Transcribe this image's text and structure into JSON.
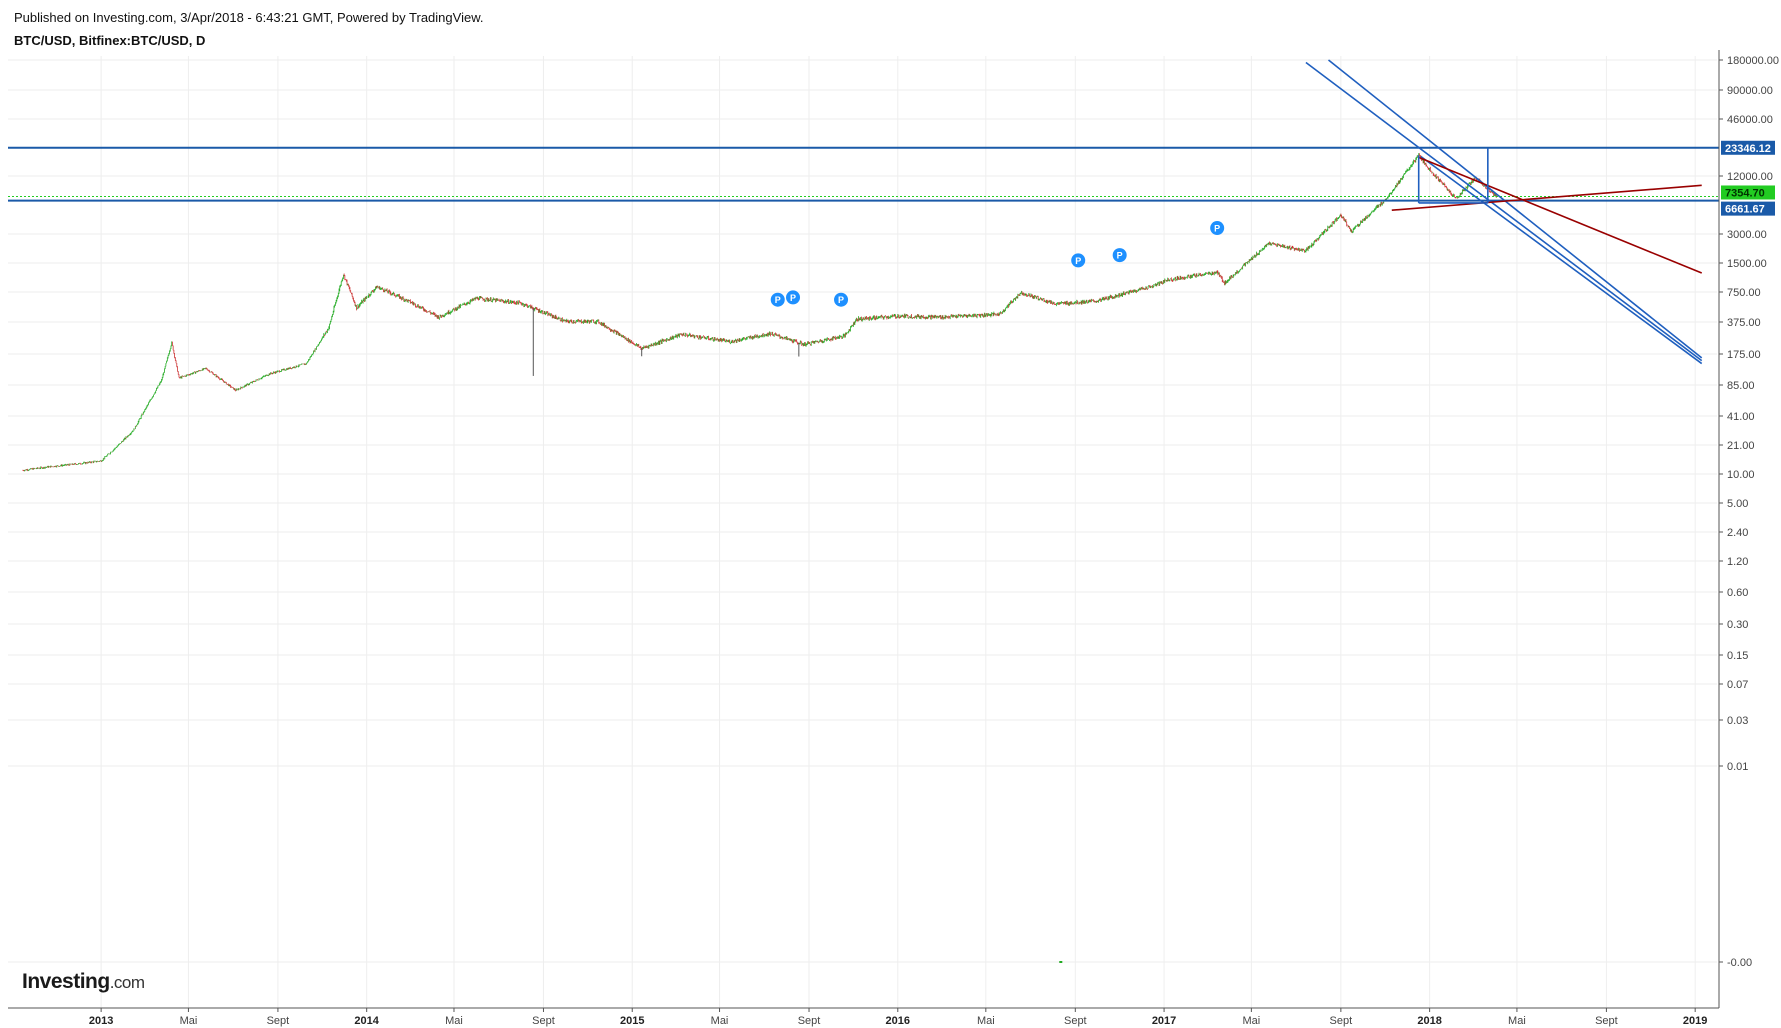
{
  "header": {
    "published": "Published on Investing.com, 3/Apr/2018 - 6:43:21 GMT, Powered by TradingView.",
    "symbol": "BTC/USD, Bitfinex:BTC/USD, D"
  },
  "logo": {
    "name": "Investing",
    "tld": ".com"
  },
  "colors": {
    "up": "#22aa22",
    "down": "#cc3333",
    "trend_blue": "#1f5fbf",
    "trend_red": "#990000",
    "badge_blue": "#1a5aa8",
    "badge_green": "#22cc22",
    "pivot": "#1e90ff",
    "grid": "#eeeeee"
  },
  "chart_data": {
    "type": "candlestick",
    "scale": "log",
    "grid": true,
    "x_ticks": [
      {
        "label": "2013",
        "date": "2013-01-01",
        "year": true
      },
      {
        "label": "Mai",
        "date": "2013-05-01"
      },
      {
        "label": "Sept",
        "date": "2013-09-01"
      },
      {
        "label": "2014",
        "date": "2014-01-01",
        "year": true
      },
      {
        "label": "Mai",
        "date": "2014-05-01"
      },
      {
        "label": "Sept",
        "date": "2014-09-01"
      },
      {
        "label": "2015",
        "date": "2015-01-01",
        "year": true
      },
      {
        "label": "Mai",
        "date": "2015-05-01"
      },
      {
        "label": "Sept",
        "date": "2015-09-01"
      },
      {
        "label": "2016",
        "date": "2016-01-01",
        "year": true
      },
      {
        "label": "Mai",
        "date": "2016-05-01"
      },
      {
        "label": "Sept",
        "date": "2016-09-01"
      },
      {
        "label": "2017",
        "date": "2017-01-01",
        "year": true
      },
      {
        "label": "Mai",
        "date": "2017-05-01"
      },
      {
        "label": "Sept",
        "date": "2017-09-01"
      },
      {
        "label": "2018",
        "date": "2018-01-01",
        "year": true
      },
      {
        "label": "Mai",
        "date": "2018-05-01"
      },
      {
        "label": "Sept",
        "date": "2018-09-01"
      },
      {
        "label": "2019",
        "date": "2019-01-01",
        "year": true
      }
    ],
    "y_ticks": [
      {
        "label": "180000.00",
        "value": 180000
      },
      {
        "label": "90000.00",
        "value": 90000
      },
      {
        "label": "46000.00",
        "value": 46000
      },
      {
        "label": "12000.00",
        "value": 12000
      },
      {
        "label": "3000.00",
        "value": 3000
      },
      {
        "label": "1500.00",
        "value": 1500
      },
      {
        "label": "750.00",
        "value": 750
      },
      {
        "label": "375.00",
        "value": 375
      },
      {
        "label": "175.00",
        "value": 175
      },
      {
        "label": "85.00",
        "value": 85
      },
      {
        "label": "41.00",
        "value": 41
      },
      {
        "label": "21.00",
        "value": 21
      },
      {
        "label": "10.00",
        "value": 10
      },
      {
        "label": "5.00",
        "value": 5
      },
      {
        "label": "2.40",
        "value": 2.4
      },
      {
        "label": "1.20",
        "value": 1.2
      },
      {
        "label": "0.60",
        "value": 0.6
      },
      {
        "label": "0.30",
        "value": 0.3
      },
      {
        "label": "0.15",
        "value": 0.15
      },
      {
        "label": "0.07",
        "value": 0.07
      },
      {
        "label": "0.03",
        "value": 0.03
      },
      {
        "label": "0.01",
        "value": 0.01
      },
      {
        "label": "-0.00",
        "value": 0.0001
      }
    ],
    "price_series": [
      {
        "date": "2012-09-15",
        "price": 11
      },
      {
        "date": "2012-10-20",
        "price": 12
      },
      {
        "date": "2012-12-01",
        "price": 13
      },
      {
        "date": "2013-01-01",
        "price": 14
      },
      {
        "date": "2013-02-15",
        "price": 30
      },
      {
        "date": "2013-03-25",
        "price": 95
      },
      {
        "date": "2013-04-08",
        "price": 230
      },
      {
        "date": "2013-04-18",
        "price": 100
      },
      {
        "date": "2013-05-25",
        "price": 125
      },
      {
        "date": "2013-07-05",
        "price": 75
      },
      {
        "date": "2013-08-20",
        "price": 110
      },
      {
        "date": "2013-10-10",
        "price": 140
      },
      {
        "date": "2013-11-10",
        "price": 330
      },
      {
        "date": "2013-11-30",
        "price": 1150
      },
      {
        "date": "2013-12-18",
        "price": 520
      },
      {
        "date": "2014-01-15",
        "price": 850
      },
      {
        "date": "2014-03-01",
        "price": 600
      },
      {
        "date": "2014-04-10",
        "price": 420
      },
      {
        "date": "2014-06-01",
        "price": 650
      },
      {
        "date": "2014-08-01",
        "price": 580
      },
      {
        "date": "2014-10-01",
        "price": 380
      },
      {
        "date": "2014-11-15",
        "price": 380
      },
      {
        "date": "2015-01-14",
        "price": 200
      },
      {
        "date": "2015-03-10",
        "price": 280
      },
      {
        "date": "2015-05-15",
        "price": 235
      },
      {
        "date": "2015-07-10",
        "price": 285
      },
      {
        "date": "2015-08-25",
        "price": 220
      },
      {
        "date": "2015-10-20",
        "price": 270
      },
      {
        "date": "2015-11-05",
        "price": 400
      },
      {
        "date": "2016-01-01",
        "price": 430
      },
      {
        "date": "2016-03-01",
        "price": 420
      },
      {
        "date": "2016-05-20",
        "price": 450
      },
      {
        "date": "2016-06-18",
        "price": 740
      },
      {
        "date": "2016-08-05",
        "price": 570
      },
      {
        "date": "2016-10-01",
        "price": 610
      },
      {
        "date": "2016-12-20",
        "price": 880
      },
      {
        "date": "2017-01-05",
        "price": 1000
      },
      {
        "date": "2017-03-15",
        "price": 1200
      },
      {
        "date": "2017-03-25",
        "price": 930
      },
      {
        "date": "2017-05-25",
        "price": 2400
      },
      {
        "date": "2017-07-15",
        "price": 2000
      },
      {
        "date": "2017-09-01",
        "price": 4800
      },
      {
        "date": "2017-09-15",
        "price": 3200
      },
      {
        "date": "2017-11-01",
        "price": 6800
      },
      {
        "date": "2017-12-17",
        "price": 19500
      },
      {
        "date": "2018-01-01",
        "price": 14000
      },
      {
        "date": "2018-02-06",
        "price": 7000
      },
      {
        "date": "2018-03-05",
        "price": 11500
      },
      {
        "date": "2018-04-03",
        "price": 7354.7
      }
    ],
    "spikes": [
      {
        "date": "2014-08-18",
        "low": 105
      },
      {
        "date": "2015-01-14",
        "low": 166
      },
      {
        "date": "2015-08-18",
        "low": 165
      }
    ],
    "pivot_markers": [
      {
        "label": "P",
        "date": "2015-07-20",
        "price": 360
      },
      {
        "label": "P",
        "date": "2015-08-10",
        "price": 380
      },
      {
        "label": "P",
        "date": "2015-10-15",
        "price": 360
      },
      {
        "label": "P",
        "date": "2016-09-05",
        "price": 900
      },
      {
        "label": "P",
        "date": "2016-11-01",
        "price": 1020
      },
      {
        "label": "P",
        "date": "2017-03-15",
        "price": 1950
      }
    ],
    "horizontal_levels": [
      {
        "price": 23346.12,
        "label": "23346.12",
        "color": "#1a5aa8"
      },
      {
        "price": 6661.67,
        "label": "6661.67",
        "color": "#1a5aa8"
      },
      {
        "price": 7354.7,
        "label": "7354.70",
        "color": "#22cc22",
        "dotted": true
      }
    ],
    "trendlines": [
      {
        "color": "#1f5fbf",
        "from": {
          "date": "2017-07-15",
          "price": 170000
        },
        "to": {
          "date": "2019-01-10",
          "price": 150
        }
      },
      {
        "color": "#1f5fbf",
        "from": {
          "date": "2017-08-15",
          "price": 180000
        },
        "to": {
          "date": "2019-01-10",
          "price": 160
        }
      },
      {
        "color": "#1f5fbf",
        "from": {
          "date": "2017-12-20",
          "price": 19000
        },
        "to": {
          "date": "2019-01-10",
          "price": 140
        }
      },
      {
        "color": "#990000",
        "from": {
          "date": "2017-12-18",
          "price": 18500
        },
        "to": {
          "date": "2019-01-10",
          "price": 1180
        }
      },
      {
        "color": "#990000",
        "from": {
          "date": "2017-11-10",
          "price": 5300
        },
        "to": {
          "date": "2019-01-10",
          "price": 9600
        }
      },
      {
        "color": "#1f5fbf",
        "from": {
          "date": "2017-12-17",
          "price": 19500
        },
        "to": {
          "date": "2017-12-17",
          "price": 6300
        }
      },
      {
        "color": "#1f5fbf",
        "from": {
          "date": "2017-12-17",
          "price": 6300
        },
        "to": {
          "date": "2018-03-22",
          "price": 6300
        }
      },
      {
        "color": "#1f5fbf",
        "from": {
          "date": "2018-03-22",
          "price": 6300
        },
        "to": {
          "date": "2018-03-22",
          "price": 23346.12
        }
      }
    ],
    "stray_points": [
      {
        "date": "2016-08-10",
        "price": 0.0001
      }
    ]
  }
}
